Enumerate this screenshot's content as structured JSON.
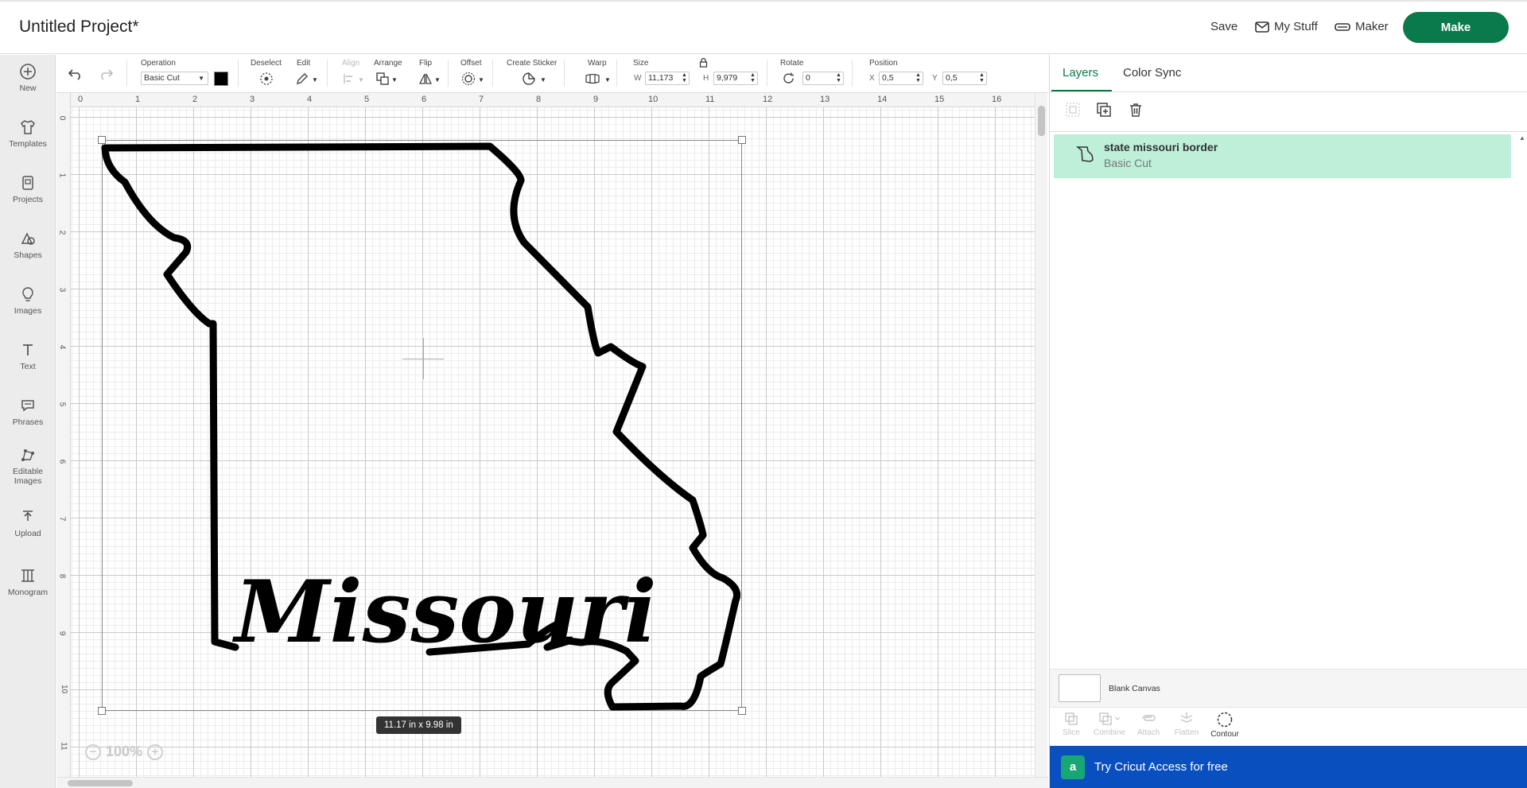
{
  "header": {
    "title": "Untitled Project*",
    "save": "Save",
    "my_stuff": "My Stuff",
    "maker": "Maker",
    "make": "Make"
  },
  "sidebar": {
    "items": [
      {
        "label": "New",
        "icon": "plus-circle-icon"
      },
      {
        "label": "Templates",
        "icon": "shirt-icon"
      },
      {
        "label": "Projects",
        "icon": "projects-icon"
      },
      {
        "label": "Shapes",
        "icon": "shapes-icon"
      },
      {
        "label": "Images",
        "icon": "lightbulb-icon"
      },
      {
        "label": "Text",
        "icon": "text-icon"
      },
      {
        "label": "Phrases",
        "icon": "speech-bubble-icon"
      },
      {
        "label": "Editable",
        "label2": "Images",
        "icon": "editable-images-icon"
      },
      {
        "label": "Upload",
        "icon": "upload-icon"
      },
      {
        "label": "Monogram",
        "icon": "monogram-icon"
      }
    ]
  },
  "toolbar": {
    "operation_label": "Operation",
    "operation_value": "Basic Cut",
    "deselect": "Deselect",
    "edit": "Edit",
    "align": "Align",
    "arrange": "Arrange",
    "flip": "Flip",
    "offset": "Offset",
    "create_sticker": "Create Sticker",
    "warp": "Warp",
    "size": "Size",
    "w_label": "W",
    "w_value": "11,173",
    "h_label": "H",
    "h_value": "9,979",
    "rotate": "Rotate",
    "rotate_value": "0",
    "position": "Position",
    "x_label": "X",
    "x_value": "0,5",
    "y_label": "Y",
    "y_value": "0,5",
    "accent": "#0b7a4b"
  },
  "canvas": {
    "ruler_top": [
      "0",
      "1",
      "2",
      "3",
      "4",
      "5",
      "6",
      "7",
      "8",
      "9",
      "10",
      "11",
      "12",
      "13",
      "14",
      "15",
      "16"
    ],
    "ruler_left": [
      "0",
      "1",
      "2",
      "3",
      "4",
      "5",
      "6",
      "7",
      "8",
      "9",
      "10",
      "11"
    ],
    "artwork_text": "Missouri",
    "size_readout": "11.17  in x 9.98  in",
    "zoom": "100%"
  },
  "panel": {
    "tab_layers": "Layers",
    "tab_color_sync": "Color Sync",
    "layer_name": "state missouri border",
    "layer_operation": "Basic Cut",
    "blank_canvas": "Blank Canvas",
    "tools": [
      "Slice",
      "Combine",
      "Attach",
      "Flatten",
      "Contour"
    ],
    "access_badge": "a",
    "access_text": "Try Cricut Access for free",
    "access_color": "#0a4fbf"
  }
}
